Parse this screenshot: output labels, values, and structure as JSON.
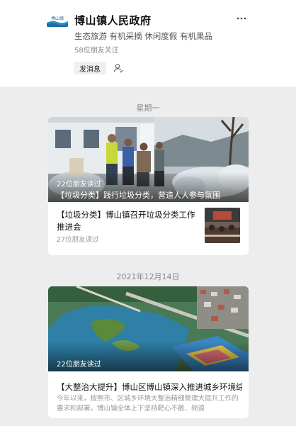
{
  "account": {
    "name": "博山镇人民政府",
    "logo_text": "博山镇",
    "description": "生态旅游 有机采摘 休闲度假 有机果品",
    "followers": "58位朋友关注",
    "send_message_label": "发消息",
    "more_icon": "ellipsis-icon",
    "follow_icon": "user-follow-icon"
  },
  "feed": {
    "groups": [
      {
        "date": "星期一",
        "main": {
          "reads": "22位朋友读过",
          "caption": "【垃圾分类】践行垃圾分类，营造人人参与氛围"
        },
        "sub": {
          "title": "【垃圾分类】博山镇召开垃圾分类工作推进会",
          "reads": "27位朋友读过"
        }
      },
      {
        "date": "2021年12月14日",
        "main": {
          "reads": "22位朋友读过",
          "title": "【大整治大提升】博山区博山镇深入推进城乡环境综…",
          "summary": "今年以来，按照市、区城乡环境大整治精细管理大提升工作的要求和部署，博山镇全体上下坚持靶心不散、频道"
        }
      }
    ]
  }
}
